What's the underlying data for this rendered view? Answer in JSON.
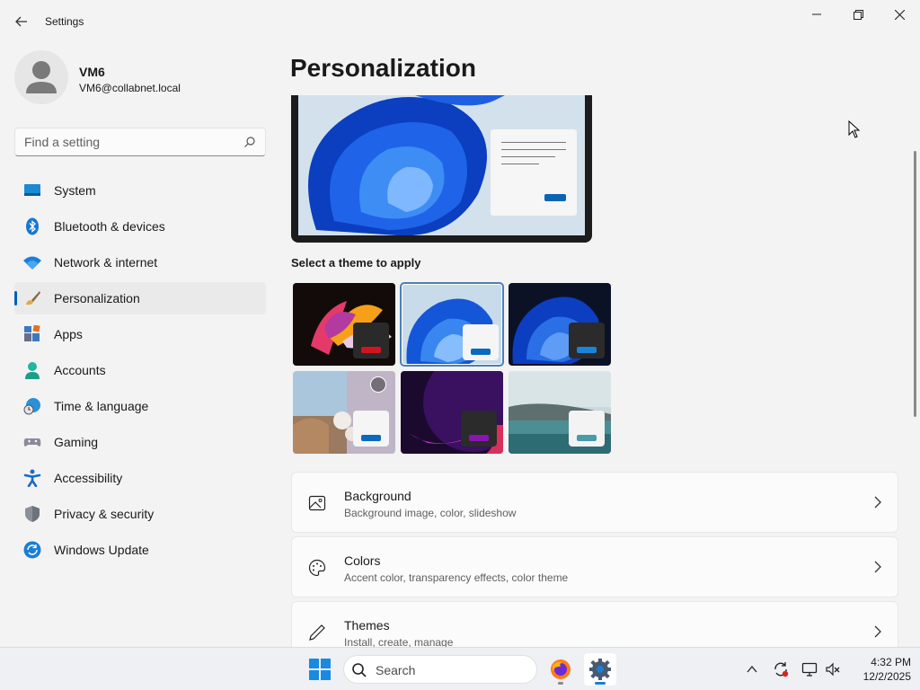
{
  "window": {
    "title": "Settings"
  },
  "user": {
    "name": "VM6",
    "email": "VM6@collabnet.local"
  },
  "search": {
    "placeholder": "Find a setting"
  },
  "nav": {
    "items": [
      {
        "label": "System",
        "icon": "system-icon"
      },
      {
        "label": "Bluetooth & devices",
        "icon": "bluetooth-icon"
      },
      {
        "label": "Network & internet",
        "icon": "wifi-icon"
      },
      {
        "label": "Personalization",
        "icon": "brush-icon",
        "active": true
      },
      {
        "label": "Apps",
        "icon": "apps-icon"
      },
      {
        "label": "Accounts",
        "icon": "person-icon"
      },
      {
        "label": "Time & language",
        "icon": "globe-clock-icon"
      },
      {
        "label": "Gaming",
        "icon": "controller-icon"
      },
      {
        "label": "Accessibility",
        "icon": "accessibility-icon"
      },
      {
        "label": "Privacy & security",
        "icon": "shield-icon"
      },
      {
        "label": "Windows Update",
        "icon": "update-icon"
      }
    ]
  },
  "main": {
    "title": "Personalization",
    "theme_heading": "Select a theme to apply",
    "themes": [
      {
        "name": "flower",
        "selected": false
      },
      {
        "name": "windows-light",
        "selected": true
      },
      {
        "name": "windows-dark",
        "selected": false
      },
      {
        "name": "spotlight",
        "selected": false
      },
      {
        "name": "glow",
        "selected": false
      },
      {
        "name": "captured-motion",
        "selected": false
      }
    ],
    "cards": [
      {
        "title": "Background",
        "subtitle": "Background image, color, slideshow",
        "icon": "image-icon"
      },
      {
        "title": "Colors",
        "subtitle": "Accent color, transparency effects, color theme",
        "icon": "palette-icon"
      },
      {
        "title": "Themes",
        "subtitle": "Install, create, manage",
        "icon": "pen-icon"
      }
    ]
  },
  "taskbar": {
    "search_label": "Search",
    "time": "4:32 PM",
    "date": "12/2/2025"
  },
  "colors": {
    "accent": "#005fb8",
    "background": "#f3f3f3"
  }
}
